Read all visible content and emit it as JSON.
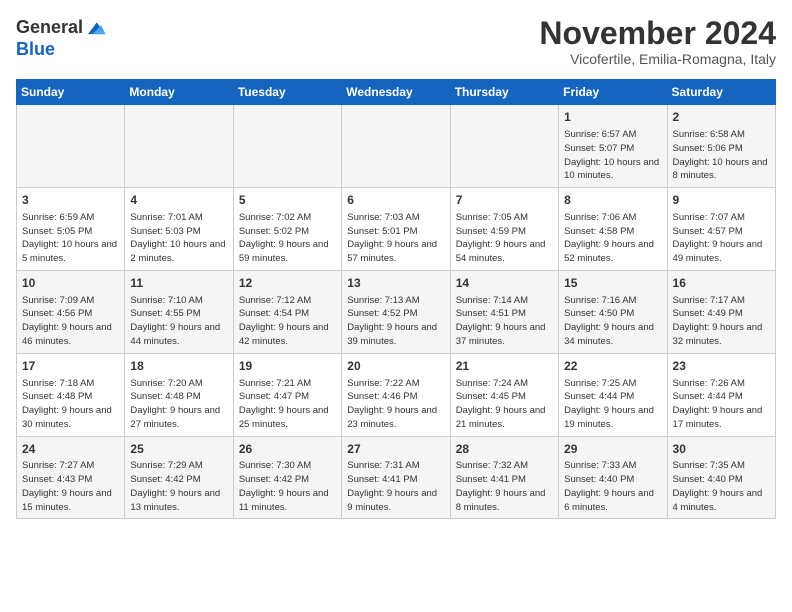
{
  "logo": {
    "line1": "General",
    "line2": "Blue"
  },
  "title": "November 2024",
  "subtitle": "Vicofertile, Emilia-Romagna, Italy",
  "weekdays": [
    "Sunday",
    "Monday",
    "Tuesday",
    "Wednesday",
    "Thursday",
    "Friday",
    "Saturday"
  ],
  "weeks": [
    [
      {
        "day": "",
        "info": ""
      },
      {
        "day": "",
        "info": ""
      },
      {
        "day": "",
        "info": ""
      },
      {
        "day": "",
        "info": ""
      },
      {
        "day": "",
        "info": ""
      },
      {
        "day": "1",
        "info": "Sunrise: 6:57 AM\nSunset: 5:07 PM\nDaylight: 10 hours and 10 minutes."
      },
      {
        "day": "2",
        "info": "Sunrise: 6:58 AM\nSunset: 5:06 PM\nDaylight: 10 hours and 8 minutes."
      }
    ],
    [
      {
        "day": "3",
        "info": "Sunrise: 6:59 AM\nSunset: 5:05 PM\nDaylight: 10 hours and 5 minutes."
      },
      {
        "day": "4",
        "info": "Sunrise: 7:01 AM\nSunset: 5:03 PM\nDaylight: 10 hours and 2 minutes."
      },
      {
        "day": "5",
        "info": "Sunrise: 7:02 AM\nSunset: 5:02 PM\nDaylight: 9 hours and 59 minutes."
      },
      {
        "day": "6",
        "info": "Sunrise: 7:03 AM\nSunset: 5:01 PM\nDaylight: 9 hours and 57 minutes."
      },
      {
        "day": "7",
        "info": "Sunrise: 7:05 AM\nSunset: 4:59 PM\nDaylight: 9 hours and 54 minutes."
      },
      {
        "day": "8",
        "info": "Sunrise: 7:06 AM\nSunset: 4:58 PM\nDaylight: 9 hours and 52 minutes."
      },
      {
        "day": "9",
        "info": "Sunrise: 7:07 AM\nSunset: 4:57 PM\nDaylight: 9 hours and 49 minutes."
      }
    ],
    [
      {
        "day": "10",
        "info": "Sunrise: 7:09 AM\nSunset: 4:56 PM\nDaylight: 9 hours and 46 minutes."
      },
      {
        "day": "11",
        "info": "Sunrise: 7:10 AM\nSunset: 4:55 PM\nDaylight: 9 hours and 44 minutes."
      },
      {
        "day": "12",
        "info": "Sunrise: 7:12 AM\nSunset: 4:54 PM\nDaylight: 9 hours and 42 minutes."
      },
      {
        "day": "13",
        "info": "Sunrise: 7:13 AM\nSunset: 4:52 PM\nDaylight: 9 hours and 39 minutes."
      },
      {
        "day": "14",
        "info": "Sunrise: 7:14 AM\nSunset: 4:51 PM\nDaylight: 9 hours and 37 minutes."
      },
      {
        "day": "15",
        "info": "Sunrise: 7:16 AM\nSunset: 4:50 PM\nDaylight: 9 hours and 34 minutes."
      },
      {
        "day": "16",
        "info": "Sunrise: 7:17 AM\nSunset: 4:49 PM\nDaylight: 9 hours and 32 minutes."
      }
    ],
    [
      {
        "day": "17",
        "info": "Sunrise: 7:18 AM\nSunset: 4:48 PM\nDaylight: 9 hours and 30 minutes."
      },
      {
        "day": "18",
        "info": "Sunrise: 7:20 AM\nSunset: 4:48 PM\nDaylight: 9 hours and 27 minutes."
      },
      {
        "day": "19",
        "info": "Sunrise: 7:21 AM\nSunset: 4:47 PM\nDaylight: 9 hours and 25 minutes."
      },
      {
        "day": "20",
        "info": "Sunrise: 7:22 AM\nSunset: 4:46 PM\nDaylight: 9 hours and 23 minutes."
      },
      {
        "day": "21",
        "info": "Sunrise: 7:24 AM\nSunset: 4:45 PM\nDaylight: 9 hours and 21 minutes."
      },
      {
        "day": "22",
        "info": "Sunrise: 7:25 AM\nSunset: 4:44 PM\nDaylight: 9 hours and 19 minutes."
      },
      {
        "day": "23",
        "info": "Sunrise: 7:26 AM\nSunset: 4:44 PM\nDaylight: 9 hours and 17 minutes."
      }
    ],
    [
      {
        "day": "24",
        "info": "Sunrise: 7:27 AM\nSunset: 4:43 PM\nDaylight: 9 hours and 15 minutes."
      },
      {
        "day": "25",
        "info": "Sunrise: 7:29 AM\nSunset: 4:42 PM\nDaylight: 9 hours and 13 minutes."
      },
      {
        "day": "26",
        "info": "Sunrise: 7:30 AM\nSunset: 4:42 PM\nDaylight: 9 hours and 11 minutes."
      },
      {
        "day": "27",
        "info": "Sunrise: 7:31 AM\nSunset: 4:41 PM\nDaylight: 9 hours and 9 minutes."
      },
      {
        "day": "28",
        "info": "Sunrise: 7:32 AM\nSunset: 4:41 PM\nDaylight: 9 hours and 8 minutes."
      },
      {
        "day": "29",
        "info": "Sunrise: 7:33 AM\nSunset: 4:40 PM\nDaylight: 9 hours and 6 minutes."
      },
      {
        "day": "30",
        "info": "Sunrise: 7:35 AM\nSunset: 4:40 PM\nDaylight: 9 hours and 4 minutes."
      }
    ]
  ]
}
